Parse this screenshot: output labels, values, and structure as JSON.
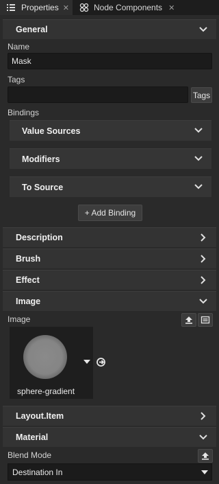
{
  "tabs": [
    {
      "label": "Properties",
      "icon": "list-icon"
    },
    {
      "label": "Node Components",
      "icon": "node-components-icon"
    }
  ],
  "sections": {
    "general": "General",
    "description": "Description",
    "brush": "Brush",
    "effect": "Effect",
    "image": "Image",
    "layout_item": "Layout.Item",
    "material": "Material"
  },
  "general": {
    "name_label": "Name",
    "name_value": "Mask",
    "tags_label": "Tags",
    "tags_value": "",
    "tags_button": "Tags",
    "bindings_label": "Bindings",
    "binding_groups": [
      "Value Sources",
      "Modifiers",
      "To Source"
    ],
    "add_binding": "+ Add Binding"
  },
  "image": {
    "label": "Image",
    "texture_name": "sphere-gradient"
  },
  "material": {
    "blend_mode_label": "Blend Mode",
    "blend_mode_value": "Destination In"
  }
}
